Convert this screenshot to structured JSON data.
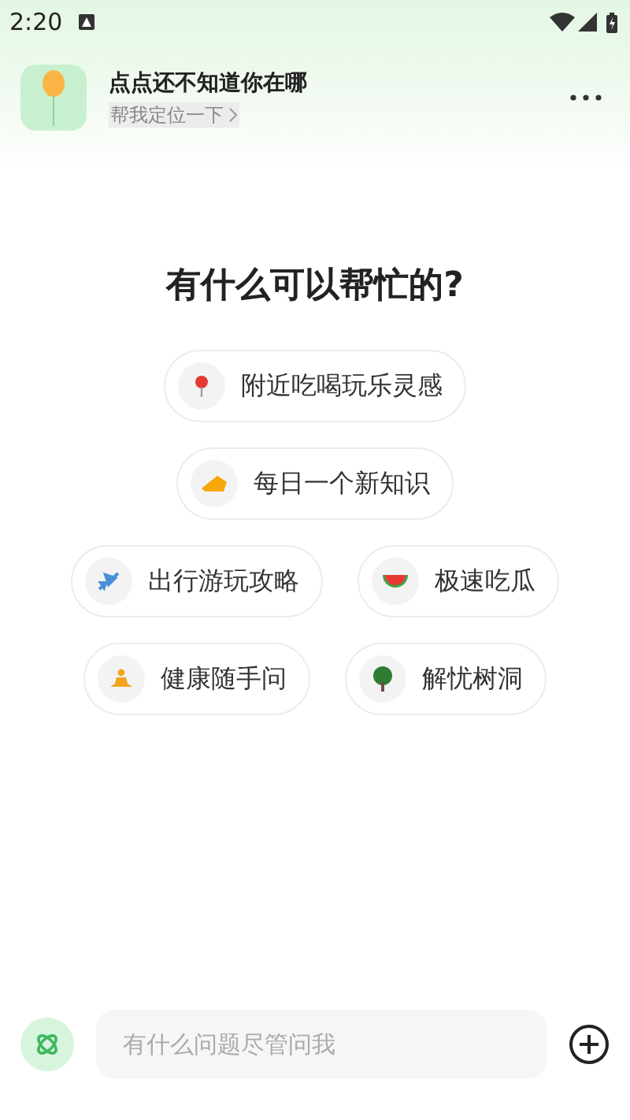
{
  "status_bar": {
    "time": "2:20"
  },
  "header": {
    "title": "点点还不知道你在哪",
    "location_link": "帮我定位一下"
  },
  "heading": "有什么可以帮忙的?",
  "suggestion_rows": [
    [
      {
        "label": "附近吃喝玩乐灵感"
      }
    ],
    [
      {
        "label": "每日一个新知识"
      }
    ],
    [
      {
        "label": "出行游玩攻略"
      },
      {
        "label": "极速吃瓜"
      }
    ],
    [
      {
        "label": "健康随手问"
      },
      {
        "label": "解忧树洞"
      }
    ]
  ],
  "input": {
    "placeholder": "有什么问题尽管问我"
  }
}
